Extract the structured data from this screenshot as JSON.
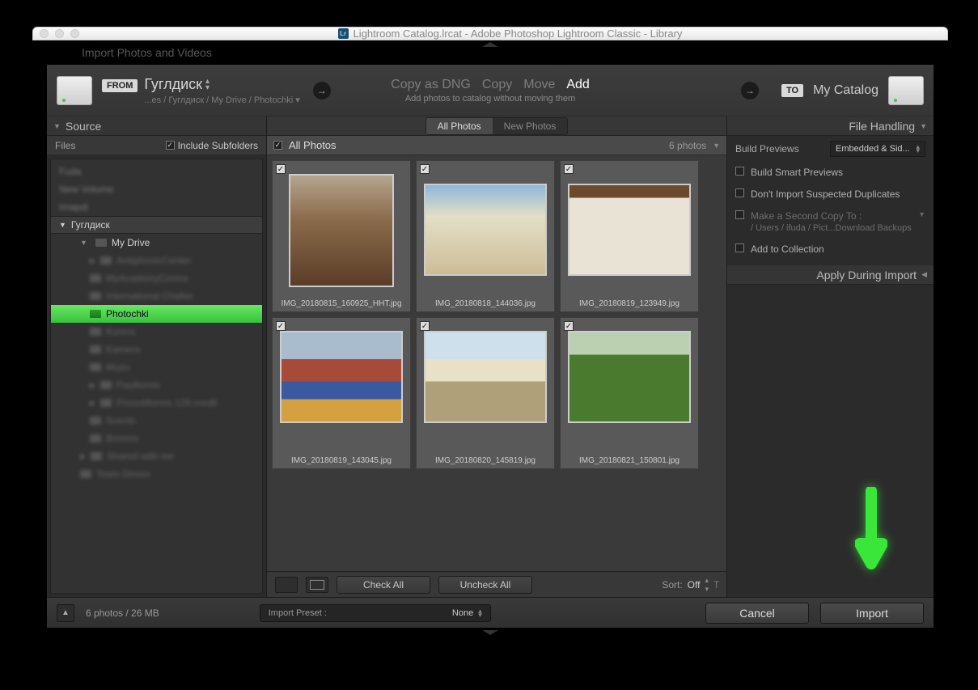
{
  "window": {
    "title": "Lightroom Catalog.lrcat - Adobe Photoshop Lightroom Classic - Library",
    "hidden_header": "Import Photos and Videos"
  },
  "header": {
    "from_badge": "FROM",
    "from_title": "Гуглдиск",
    "from_path": "...es / Гуглдиск / My Drive / Photochki ▾",
    "actions": {
      "copy_dng": "Copy as DNG",
      "copy": "Copy",
      "move": "Move",
      "add": "Add"
    },
    "action_sub": "Add photos to catalog without moving them",
    "to_badge": "TO",
    "to_title": "My Catalog"
  },
  "source": {
    "panel_title": "Source",
    "files_label": "Files",
    "include_sub": "Include Subfolders",
    "root_name": "Гуглдиск",
    "mydrive": "My Drive",
    "selected_folder": "Photochki"
  },
  "center": {
    "seg_all": "All Photos",
    "seg_new": "New Photos",
    "bar_title": "All Photos",
    "bar_count": "6 photos",
    "check_all": "Check All",
    "uncheck_all": "Uncheck All",
    "sort_label": "Sort:",
    "sort_val": "Off",
    "thumbs_label": "Thumbnails"
  },
  "photos": [
    {
      "name": "IMG_20180815_160925_HHT.jpg",
      "orient": "port",
      "cls": "th-kitchen"
    },
    {
      "name": "IMG_20180818_144036.jpg",
      "orient": "land",
      "cls": "th-beach"
    },
    {
      "name": "IMG_20180819_123949.jpg",
      "orient": "land",
      "cls": "th-mugs"
    },
    {
      "name": "IMG_20180819_143045.jpg",
      "orient": "land2",
      "cls": "th-houses"
    },
    {
      "name": "IMG_20180820_145819.jpg",
      "orient": "land2",
      "cls": "th-board"
    },
    {
      "name": "IMG_20180821_150801.jpg",
      "orient": "land2",
      "cls": "th-park"
    }
  ],
  "right": {
    "file_handling": "File Handling",
    "build_previews": "Build Previews",
    "build_previews_val": "Embedded & Sid...",
    "smart_previews": "Build Smart Previews",
    "no_dupes": "Don't Import Suspected Duplicates",
    "second_copy": "Make a Second Copy To :",
    "second_copy_path": "/ Users / ifuda / Pict...Download Backups",
    "add_collection": "Add to Collection",
    "apply_during": "Apply During Import"
  },
  "footer": {
    "status": "6 photos / 26 MB",
    "preset_label": "Import Preset :",
    "preset_val": "None",
    "cancel": "Cancel",
    "import": "Import"
  }
}
